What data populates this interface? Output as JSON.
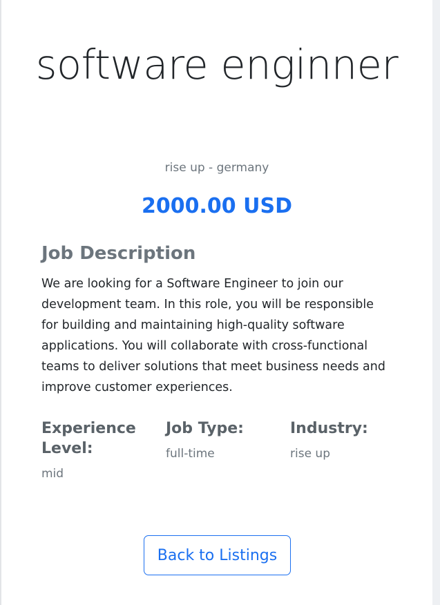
{
  "job": {
    "title": "software enginner",
    "company_location": "rise up - germany",
    "salary": "2000.00 USD"
  },
  "description": {
    "heading": "Job Description",
    "text": "We are looking for a Software Engineer to join our development team. In this role, you will be responsible for building and maintaining high-quality software applications. You will collaborate with cross-functional teams to deliver solutions that meet business needs and improve customer experiences."
  },
  "details": {
    "experience": {
      "label": "Experience Level:",
      "value": "mid"
    },
    "job_type": {
      "label": "Job Type:",
      "value": "full-time"
    },
    "industry": {
      "label": "Industry:",
      "value": "rise up"
    }
  },
  "actions": {
    "back_label": "Back to Listings"
  },
  "colors": {
    "accent": "#1a6ff0",
    "muted": "#6c757d",
    "text": "#212529"
  }
}
